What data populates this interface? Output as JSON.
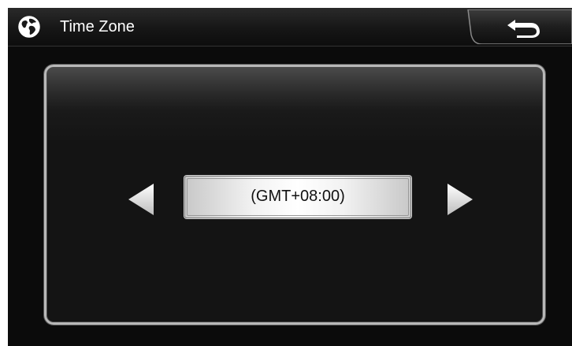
{
  "header": {
    "title": "Time Zone",
    "icon": "globe-icon",
    "back_icon": "back-arrow-icon"
  },
  "timezone": {
    "value": "(GMT+08:00)",
    "prev_icon": "triangle-left-icon",
    "next_icon": "triangle-right-icon"
  },
  "colors": {
    "background": "#0b0b0b",
    "titlebar": "#161616",
    "panel": "#141414",
    "panel_border": "#b8b8b8",
    "value_box": "#f2f2f2",
    "text_light": "#ffffff",
    "text_dark": "#111111"
  }
}
